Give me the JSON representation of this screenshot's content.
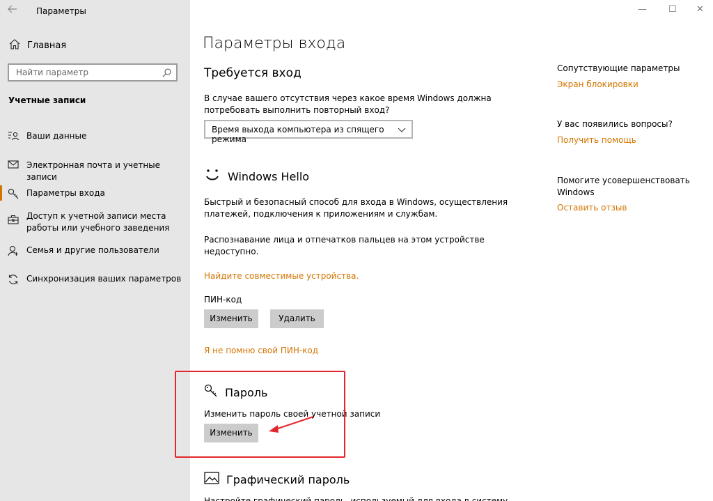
{
  "window": {
    "title": "Параметры",
    "minimize": "—",
    "maximize": "☐",
    "close": "✕"
  },
  "sidebar": {
    "home": "Главная",
    "search_placeholder": "Найти параметр",
    "section": "Учетные записи",
    "items": [
      {
        "label": "Ваши данные",
        "icon": "person-card-icon"
      },
      {
        "label": "Электронная почта и учетные записи",
        "icon": "mail-icon"
      },
      {
        "label": "Параметры входа",
        "icon": "key-icon",
        "active": true
      },
      {
        "label": "Доступ к учетной записи места работы или учебного заведения",
        "icon": "briefcase-icon"
      },
      {
        "label": "Семья и другие пользователи",
        "icon": "person-add-icon"
      },
      {
        "label": "Синхронизация ваших параметров",
        "icon": "sync-icon"
      }
    ]
  },
  "main": {
    "title": "Параметры входа",
    "signin_required": {
      "heading": "Требуется вход",
      "desc": "В случае вашего отсутствия через какое время Windows должна потребовать выполнить повторный вход?",
      "dropdown_value": "Время выхода компьютера из спящего режима"
    },
    "hello": {
      "heading": "Windows Hello",
      "desc1": "Быстрый и безопасный способ для входа в Windows, осуществления платежей, подключения к приложениям и службам.",
      "desc2": "Распознавание лица и отпечатков пальцев на этом устройстве недоступно.",
      "link": "Найдите совместимые устройства.",
      "pin_label": "ПИН-код",
      "pin_change": "Изменить",
      "pin_remove": "Удалить",
      "pin_forgot": "Я не помню свой ПИН-код"
    },
    "password": {
      "heading": "Пароль",
      "desc": "Изменить пароль своей учетной записи",
      "change": "Изменить"
    },
    "picture_password": {
      "heading": "Графический пароль",
      "desc": "Настройте графический пароль, используемый для входа в систему"
    }
  },
  "right": {
    "related_title": "Сопутствующие параметры",
    "related_link": "Экран блокировки",
    "questions_title": "У вас появились вопросы?",
    "questions_link": "Получить помощь",
    "improve_title": "Помогите усовершенствовать Windows",
    "improve_link": "Оставить отзыв"
  },
  "colors": {
    "accent": "#d47500",
    "highlight": "#e3262b",
    "sidebar_bg": "#e6e6e6",
    "button_bg": "#cccccc"
  }
}
